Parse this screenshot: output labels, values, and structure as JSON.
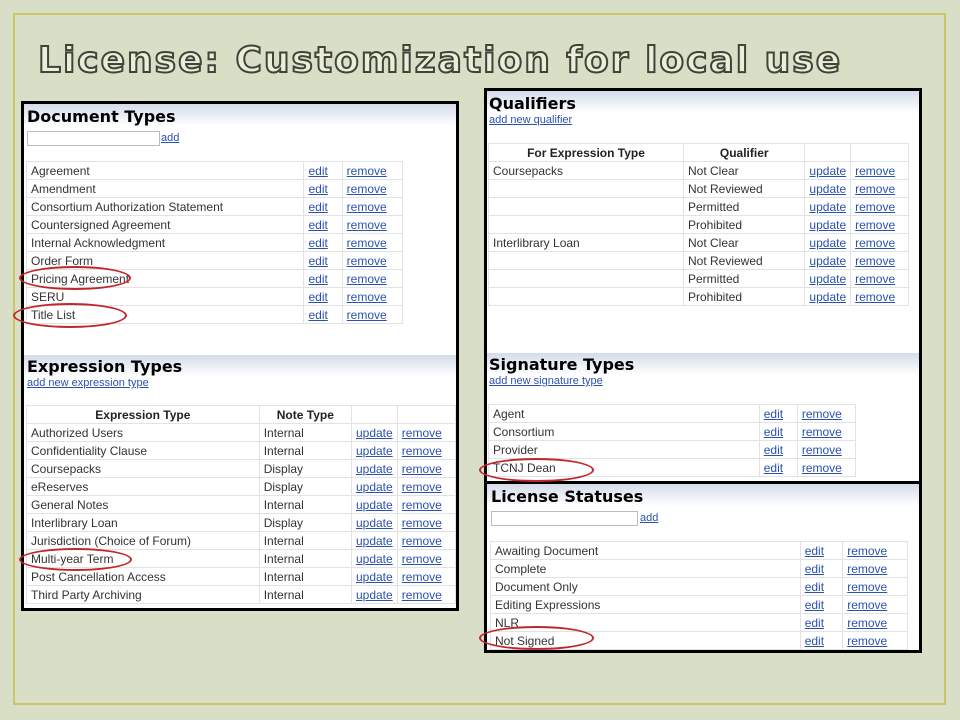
{
  "slide": {
    "title": "License: Customization for local use"
  },
  "document_types": {
    "header": "Document Types",
    "add_label": "add",
    "rows": [
      {
        "name": "Agreement",
        "edit": "edit",
        "remove": "remove"
      },
      {
        "name": "Amendment",
        "edit": "edit",
        "remove": "remove"
      },
      {
        "name": "Consortium Authorization Statement",
        "edit": "edit",
        "remove": "remove"
      },
      {
        "name": "Countersigned Agreement",
        "edit": "edit",
        "remove": "remove"
      },
      {
        "name": "Internal Acknowledgment",
        "edit": "edit",
        "remove": "remove"
      },
      {
        "name": "Order Form",
        "edit": "edit",
        "remove": "remove"
      },
      {
        "name": "Pricing Agreement",
        "edit": "edit",
        "remove": "remove"
      },
      {
        "name": "SERU",
        "edit": "edit",
        "remove": "remove"
      },
      {
        "name": "Title List",
        "edit": "edit",
        "remove": "remove"
      }
    ]
  },
  "expression_types": {
    "header": "Expression Types",
    "add_link": "add new expression type",
    "col_expression": "Expression Type",
    "col_note": "Note Type",
    "rows": [
      {
        "name": "Authorized Users",
        "note": "Internal",
        "update": "update",
        "remove": "remove"
      },
      {
        "name": "Confidentiality Clause",
        "note": "Internal",
        "update": "update",
        "remove": "remove"
      },
      {
        "name": "Coursepacks",
        "note": "Display",
        "update": "update",
        "remove": "remove"
      },
      {
        "name": "eReserves",
        "note": "Display",
        "update": "update",
        "remove": "remove"
      },
      {
        "name": "General Notes",
        "note": "Internal",
        "update": "update",
        "remove": "remove"
      },
      {
        "name": "Interlibrary Loan",
        "note": "Display",
        "update": "update",
        "remove": "remove"
      },
      {
        "name": "Jurisdiction (Choice of Forum)",
        "note": "Internal",
        "update": "update",
        "remove": "remove"
      },
      {
        "name": "Multi-year Term",
        "note": "Internal",
        "update": "update",
        "remove": "remove"
      },
      {
        "name": "Post Cancellation Access",
        "note": "Internal",
        "update": "update",
        "remove": "remove"
      },
      {
        "name": "Third Party Archiving",
        "note": "Internal",
        "update": "update",
        "remove": "remove"
      }
    ]
  },
  "qualifiers": {
    "header": "Qualifiers",
    "add_link": "add new qualifier",
    "col_for": "For Expression Type",
    "col_qualifier": "Qualifier",
    "rows": [
      {
        "for": "Coursepacks",
        "qualifier": "Not Clear",
        "update": "update",
        "remove": "remove"
      },
      {
        "for": "",
        "qualifier": "Not Reviewed",
        "update": "update",
        "remove": "remove"
      },
      {
        "for": "",
        "qualifier": "Permitted",
        "update": "update",
        "remove": "remove"
      },
      {
        "for": "",
        "qualifier": "Prohibited",
        "update": "update",
        "remove": "remove"
      },
      {
        "for": "Interlibrary Loan",
        "qualifier": "Not Clear",
        "update": "update",
        "remove": "remove"
      },
      {
        "for": "",
        "qualifier": "Not Reviewed",
        "update": "update",
        "remove": "remove"
      },
      {
        "for": "",
        "qualifier": "Permitted",
        "update": "update",
        "remove": "remove"
      },
      {
        "for": "",
        "qualifier": "Prohibited",
        "update": "update",
        "remove": "remove"
      }
    ]
  },
  "signature_types": {
    "header": "Signature Types",
    "add_link": "add new signature type",
    "rows": [
      {
        "name": "Agent",
        "edit": "edit",
        "remove": "remove"
      },
      {
        "name": "Consortium",
        "edit": "edit",
        "remove": "remove"
      },
      {
        "name": "Provider",
        "edit": "edit",
        "remove": "remove"
      },
      {
        "name": "TCNJ Dean",
        "edit": "edit",
        "remove": "remove"
      }
    ]
  },
  "license_statuses": {
    "header": "License Statuses",
    "add_label": "add",
    "rows": [
      {
        "name": "Awaiting Document",
        "edit": "edit",
        "remove": "remove"
      },
      {
        "name": "Complete",
        "edit": "edit",
        "remove": "remove"
      },
      {
        "name": "Document Only",
        "edit": "edit",
        "remove": "remove"
      },
      {
        "name": "Editing Expressions",
        "edit": "edit",
        "remove": "remove"
      },
      {
        "name": "NLR",
        "edit": "edit",
        "remove": "remove"
      },
      {
        "name": "Not Signed",
        "edit": "edit",
        "remove": "remove"
      }
    ]
  },
  "colors": {
    "highlight_circle": "#c0272d",
    "link": "#2a51b0",
    "background": "#d9dfc6"
  }
}
